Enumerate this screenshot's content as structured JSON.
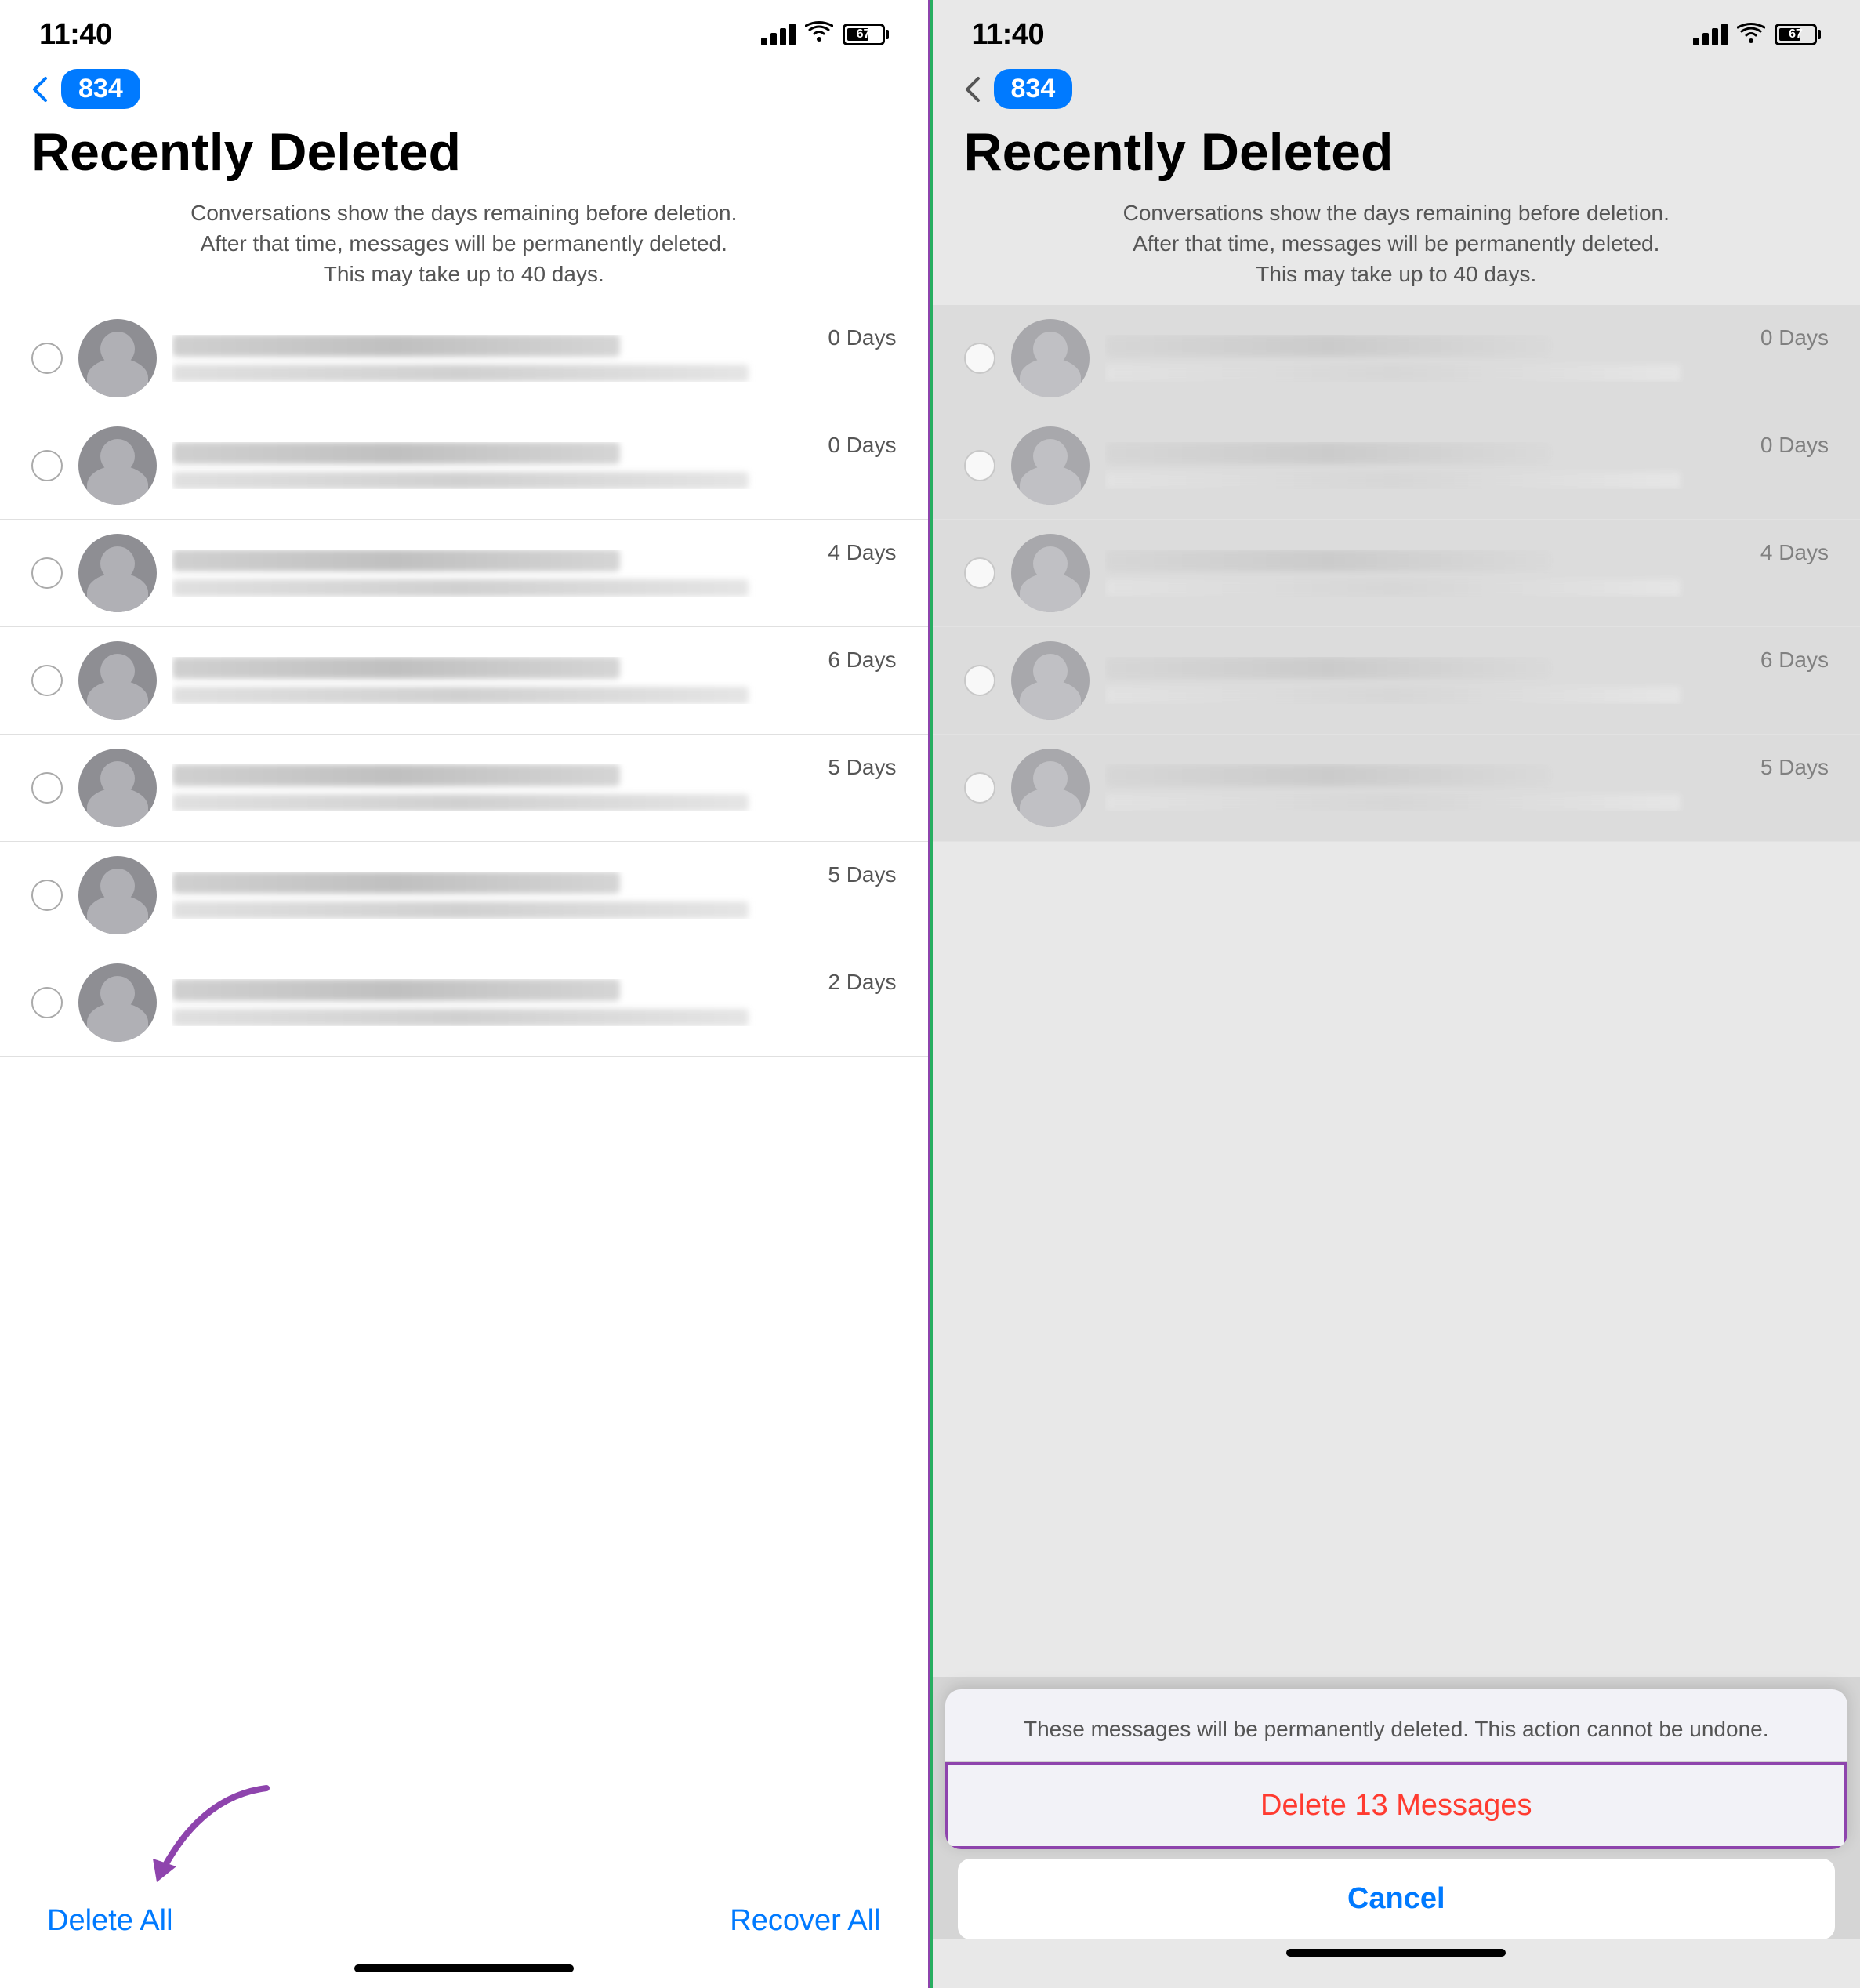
{
  "left_panel": {
    "status": {
      "time": "11:40",
      "battery": "67"
    },
    "nav": {
      "back_badge": "834"
    },
    "header": {
      "title": "Recently Deleted",
      "subtitle": "Conversations show the days remaining before deletion. After that time, messages will be permanently deleted. This may take up to 40 days."
    },
    "conversations": [
      {
        "days": "0 Days"
      },
      {
        "days": "0 Days"
      },
      {
        "days": "4 Days"
      },
      {
        "days": "6 Days"
      },
      {
        "days": "5 Days"
      },
      {
        "days": "5 Days"
      },
      {
        "days": "2 Days"
      }
    ],
    "toolbar": {
      "delete_all": "Delete All",
      "recover_all": "Recover All"
    }
  },
  "right_panel": {
    "status": {
      "time": "11:40",
      "battery": "67"
    },
    "nav": {
      "back_badge": "834"
    },
    "header": {
      "title": "Recently Deleted",
      "subtitle": "Conversations show the days remaining before deletion. After that time, messages will be permanently deleted. This may take up to 40 days."
    },
    "conversations": [
      {
        "days": "0 Days"
      },
      {
        "days": "0 Days"
      },
      {
        "days": "4 Days"
      },
      {
        "days": "6 Days"
      },
      {
        "days": "5 Days"
      }
    ],
    "action_sheet": {
      "message": "These messages will be permanently deleted. This action cannot be undone.",
      "delete_btn": "Delete 13 Messages",
      "cancel_btn": "Cancel"
    }
  }
}
